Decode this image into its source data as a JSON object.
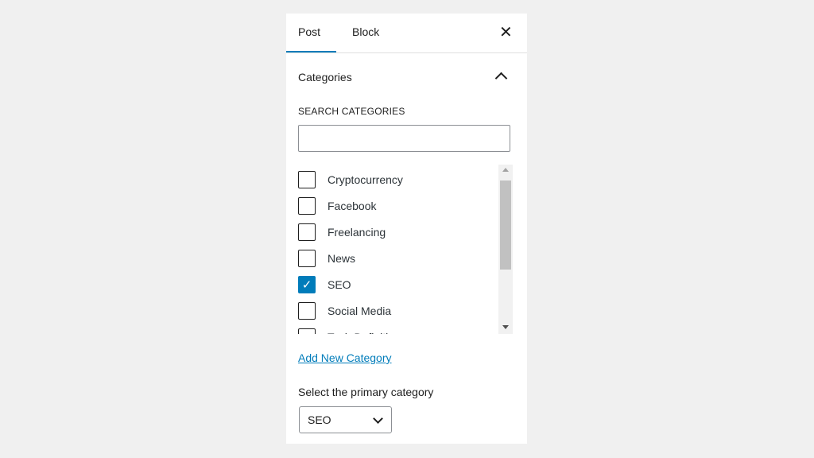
{
  "tabs": [
    {
      "label": "Post",
      "active": true
    },
    {
      "label": "Block",
      "active": false
    }
  ],
  "close_icon": "close-icon",
  "categories": {
    "title": "Categories",
    "search_label": "SEARCH CATEGORIES",
    "search_value": "",
    "items": [
      {
        "label": "Cryptocurrency",
        "checked": false
      },
      {
        "label": "Facebook",
        "checked": false
      },
      {
        "label": "Freelancing",
        "checked": false
      },
      {
        "label": "News",
        "checked": false
      },
      {
        "label": "SEO",
        "checked": true
      },
      {
        "label": "Social Media",
        "checked": false
      },
      {
        "label": "Tech Definitions",
        "checked": false
      }
    ],
    "add_new_label": "Add New Category",
    "primary_label": "Select the primary category",
    "primary_value": "SEO"
  },
  "colors": {
    "accent": "#007cba"
  }
}
